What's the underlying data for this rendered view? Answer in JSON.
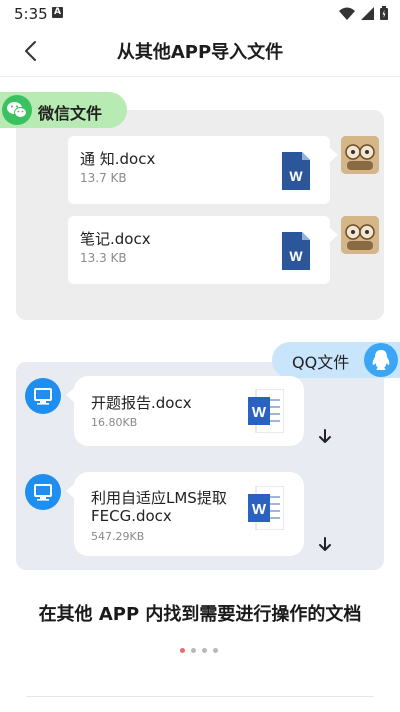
{
  "status_bar": {
    "time": "5:35",
    "notification_letter": "A"
  },
  "header": {
    "title": "从其他APP导入文件"
  },
  "wechat": {
    "tag_label": "微信文件",
    "files": [
      {
        "name": "通 知.docx",
        "size": "13.7 KB",
        "icon_letter": "W"
      },
      {
        "name": "笔记.docx",
        "size": "13.3 KB",
        "icon_letter": "W"
      }
    ]
  },
  "qq": {
    "tag_label": "QQ文件",
    "files": [
      {
        "name": "开题报告.docx",
        "size": "16.80KB",
        "icon_letter": "W"
      },
      {
        "name_line1": "利用自适应LMS提取",
        "name_line2": "FECG.docx",
        "size": "547.29KB",
        "icon_letter": "W"
      }
    ]
  },
  "onboarding": {
    "caption": "在其他 APP 内找到需要进行操作的文档",
    "page_index": 0,
    "page_count": 4
  },
  "colors": {
    "wechat_green": "#3cc160",
    "wechat_tag_bg": "#b8eab4",
    "qq_blue": "#3aa6f5",
    "qq_tag_bg": "#c8e5fb",
    "word_blue": "#2b579a",
    "dot_active": "#f06a6a"
  },
  "icons": [
    "back-chevron-icon",
    "wechat-icon",
    "qq-penguin-icon",
    "word-doc-icon",
    "computer-icon",
    "download-arrow-icon",
    "wifi-icon",
    "signal-icon",
    "battery-icon"
  ]
}
